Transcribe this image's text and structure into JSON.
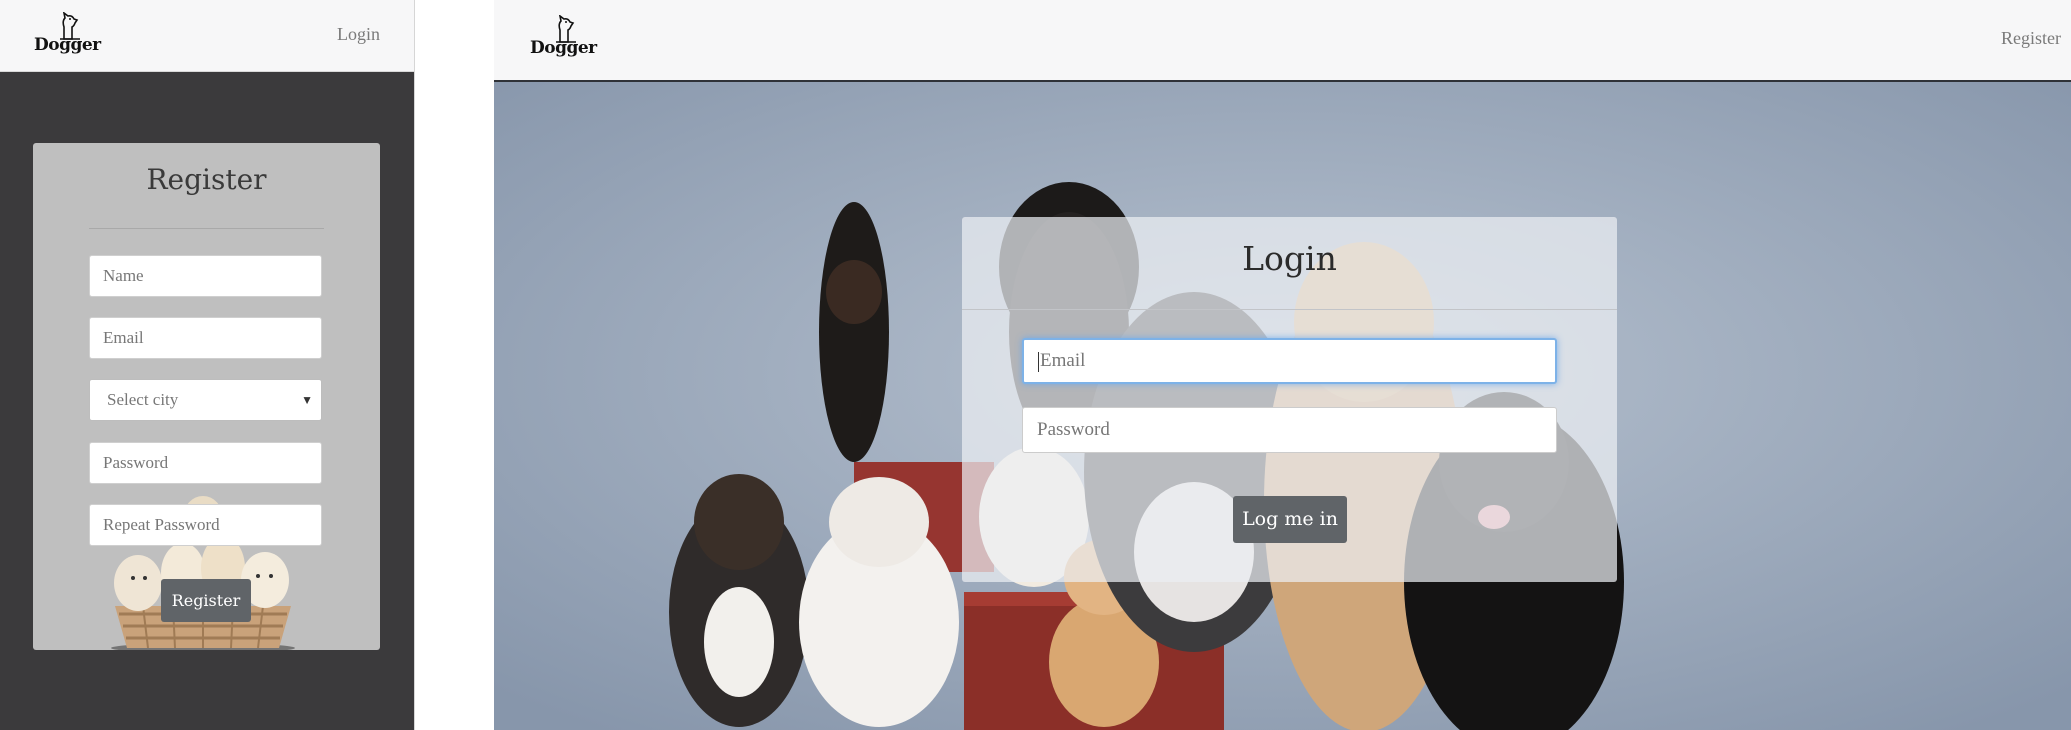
{
  "left": {
    "brand": "Dogger",
    "nav_link": "Login",
    "register": {
      "title": "Register",
      "name_placeholder": "Name",
      "email_placeholder": "Email",
      "city_select": "Select city",
      "password_placeholder": "Password",
      "repeat_password_placeholder": "Repeat Password",
      "button": "Register"
    }
  },
  "right": {
    "brand": "Dogger",
    "nav_link": "Register",
    "login": {
      "title": "Login",
      "email_placeholder": "Email",
      "password_placeholder": "Password",
      "button": "Log me in"
    }
  },
  "colors": {
    "dark_background": "#3b3a3c",
    "navbar": "#f7f7f8",
    "button": "#606468",
    "photo_backdrop": "#8e9db1",
    "focus_ring": "#7db2e8"
  }
}
